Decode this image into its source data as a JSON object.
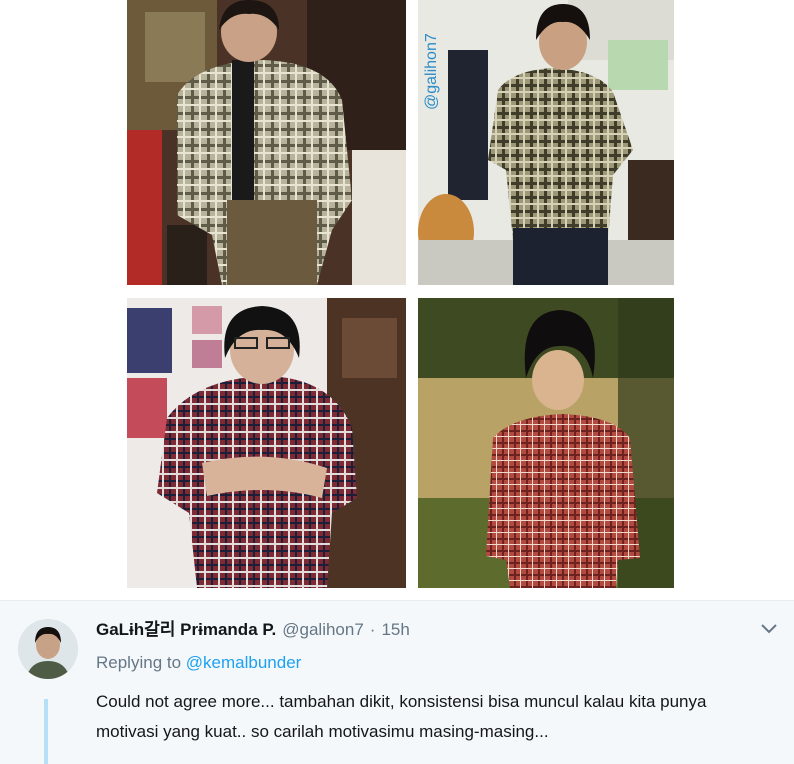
{
  "collage": {
    "watermark": "@galihon7",
    "photos": [
      {
        "name": "before-photo-top",
        "shirt": "#8b8b70"
      },
      {
        "name": "after-photo-top",
        "shirt": "#7a7a58"
      },
      {
        "name": "before-photo-bottom",
        "shirt": "#8a2f35"
      },
      {
        "name": "after-photo-bottom",
        "shirt": "#a5403a"
      }
    ]
  },
  "tweet": {
    "display_name": "GaLɨh갈리 Prɨmanda P.",
    "handle": "@galihon7",
    "separator": "·",
    "time": "15h",
    "replying_prefix": "Replying to",
    "replying_to": "@kemalbunder",
    "text_line1": "Could not agree more... tambahan dikit, konsistensi bisa muncul kalau kita punya",
    "text_line2": "motivasi yang kuat.. so carilah motivasimu masing-masing...",
    "icons": {
      "menu": "chevron-down-icon"
    },
    "colors": {
      "link": "#1da1f2",
      "secondary": "#657786",
      "thread": "#b6e0f7",
      "background": "#f5f8fa"
    }
  }
}
